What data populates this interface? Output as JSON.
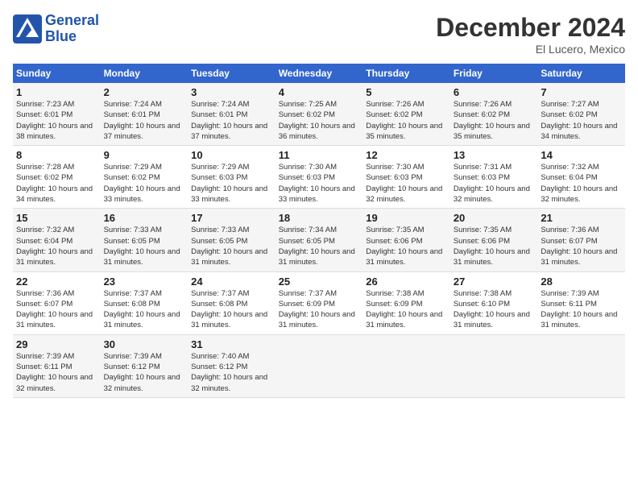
{
  "logo": {
    "line1": "General",
    "line2": "Blue"
  },
  "title": "December 2024",
  "subtitle": "El Lucero, Mexico",
  "days_header": [
    "Sunday",
    "Monday",
    "Tuesday",
    "Wednesday",
    "Thursday",
    "Friday",
    "Saturday"
  ],
  "weeks": [
    [
      {
        "num": "1",
        "sunrise": "7:23 AM",
        "sunset": "6:01 PM",
        "daylight": "10 hours and 38 minutes."
      },
      {
        "num": "2",
        "sunrise": "7:24 AM",
        "sunset": "6:01 PM",
        "daylight": "10 hours and 37 minutes."
      },
      {
        "num": "3",
        "sunrise": "7:24 AM",
        "sunset": "6:01 PM",
        "daylight": "10 hours and 37 minutes."
      },
      {
        "num": "4",
        "sunrise": "7:25 AM",
        "sunset": "6:02 PM",
        "daylight": "10 hours and 36 minutes."
      },
      {
        "num": "5",
        "sunrise": "7:26 AM",
        "sunset": "6:02 PM",
        "daylight": "10 hours and 35 minutes."
      },
      {
        "num": "6",
        "sunrise": "7:26 AM",
        "sunset": "6:02 PM",
        "daylight": "10 hours and 35 minutes."
      },
      {
        "num": "7",
        "sunrise": "7:27 AM",
        "sunset": "6:02 PM",
        "daylight": "10 hours and 34 minutes."
      }
    ],
    [
      {
        "num": "8",
        "sunrise": "7:28 AM",
        "sunset": "6:02 PM",
        "daylight": "10 hours and 34 minutes."
      },
      {
        "num": "9",
        "sunrise": "7:29 AM",
        "sunset": "6:02 PM",
        "daylight": "10 hours and 33 minutes."
      },
      {
        "num": "10",
        "sunrise": "7:29 AM",
        "sunset": "6:03 PM",
        "daylight": "10 hours and 33 minutes."
      },
      {
        "num": "11",
        "sunrise": "7:30 AM",
        "sunset": "6:03 PM",
        "daylight": "10 hours and 33 minutes."
      },
      {
        "num": "12",
        "sunrise": "7:30 AM",
        "sunset": "6:03 PM",
        "daylight": "10 hours and 32 minutes."
      },
      {
        "num": "13",
        "sunrise": "7:31 AM",
        "sunset": "6:03 PM",
        "daylight": "10 hours and 32 minutes."
      },
      {
        "num": "14",
        "sunrise": "7:32 AM",
        "sunset": "6:04 PM",
        "daylight": "10 hours and 32 minutes."
      }
    ],
    [
      {
        "num": "15",
        "sunrise": "7:32 AM",
        "sunset": "6:04 PM",
        "daylight": "10 hours and 31 minutes."
      },
      {
        "num": "16",
        "sunrise": "7:33 AM",
        "sunset": "6:05 PM",
        "daylight": "10 hours and 31 minutes."
      },
      {
        "num": "17",
        "sunrise": "7:33 AM",
        "sunset": "6:05 PM",
        "daylight": "10 hours and 31 minutes."
      },
      {
        "num": "18",
        "sunrise": "7:34 AM",
        "sunset": "6:05 PM",
        "daylight": "10 hours and 31 minutes."
      },
      {
        "num": "19",
        "sunrise": "7:35 AM",
        "sunset": "6:06 PM",
        "daylight": "10 hours and 31 minutes."
      },
      {
        "num": "20",
        "sunrise": "7:35 AM",
        "sunset": "6:06 PM",
        "daylight": "10 hours and 31 minutes."
      },
      {
        "num": "21",
        "sunrise": "7:36 AM",
        "sunset": "6:07 PM",
        "daylight": "10 hours and 31 minutes."
      }
    ],
    [
      {
        "num": "22",
        "sunrise": "7:36 AM",
        "sunset": "6:07 PM",
        "daylight": "10 hours and 31 minutes."
      },
      {
        "num": "23",
        "sunrise": "7:37 AM",
        "sunset": "6:08 PM",
        "daylight": "10 hours and 31 minutes."
      },
      {
        "num": "24",
        "sunrise": "7:37 AM",
        "sunset": "6:08 PM",
        "daylight": "10 hours and 31 minutes."
      },
      {
        "num": "25",
        "sunrise": "7:37 AM",
        "sunset": "6:09 PM",
        "daylight": "10 hours and 31 minutes."
      },
      {
        "num": "26",
        "sunrise": "7:38 AM",
        "sunset": "6:09 PM",
        "daylight": "10 hours and 31 minutes."
      },
      {
        "num": "27",
        "sunrise": "7:38 AM",
        "sunset": "6:10 PM",
        "daylight": "10 hours and 31 minutes."
      },
      {
        "num": "28",
        "sunrise": "7:39 AM",
        "sunset": "6:11 PM",
        "daylight": "10 hours and 31 minutes."
      }
    ],
    [
      {
        "num": "29",
        "sunrise": "7:39 AM",
        "sunset": "6:11 PM",
        "daylight": "10 hours and 32 minutes."
      },
      {
        "num": "30",
        "sunrise": "7:39 AM",
        "sunset": "6:12 PM",
        "daylight": "10 hours and 32 minutes."
      },
      {
        "num": "31",
        "sunrise": "7:40 AM",
        "sunset": "6:12 PM",
        "daylight": "10 hours and 32 minutes."
      },
      null,
      null,
      null,
      null
    ]
  ]
}
